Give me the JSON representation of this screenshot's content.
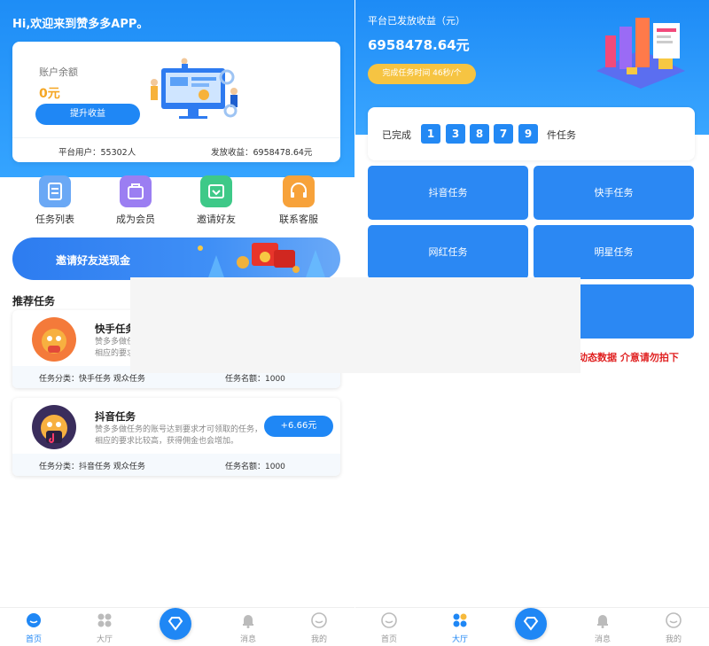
{
  "left": {
    "greeting": "Hi,欢迎来到赞多多APP。",
    "balance": {
      "label": "账户余额",
      "amount": "0元",
      "button": "提升收益",
      "platform_users": "平台用户：55302人",
      "issued_earnings": "发放收益：6958478.64元"
    },
    "menu": [
      {
        "label": "任务列表",
        "icon": "task-list-icon",
        "color": "#6aa8f5"
      },
      {
        "label": "成为会员",
        "icon": "member-icon",
        "color": "#9b7ef2"
      },
      {
        "label": "邀请好友",
        "icon": "invite-icon",
        "color": "#3ec988"
      },
      {
        "label": "联系客服",
        "icon": "service-icon",
        "color": "#f7a23a"
      }
    ],
    "invite_banner": "邀请好友送现金",
    "recommended_title": "推荐任务",
    "tasks": [
      {
        "title": "快手任务",
        "desc": "赞多多做任务的账号达到要求才可领取的任务，相应的要求比较高，获得佣金也会增加。",
        "category": "任务分类：快手任务 观众任务",
        "quota": "任务名额：1000",
        "reward": ""
      },
      {
        "title": "抖音任务",
        "desc": "赞多多做任务的账号达到要求才可领取的任务，相应的要求比较高，获得佣金也会增加。",
        "category": "任务分类：抖音任务 观众任务",
        "quota": "任务名额：1000",
        "reward": "+6.66元"
      }
    ],
    "nav": [
      "首页",
      "大厅",
      "",
      "消息",
      "我的"
    ]
  },
  "right": {
    "earnings_label": "平台已发放收益（元）",
    "earnings_amount": "6958478.64元",
    "pill": "完成任务时间 46秒/个",
    "completed_label": "已完成",
    "completed_digits": [
      "1",
      "3",
      "8",
      "7",
      "9"
    ],
    "completed_suffix": "件任务",
    "tiles": [
      "抖音任务",
      "快手任务",
      "网红任务",
      "明星任务"
    ],
    "notice": "动态数据 介意请勿拍下",
    "nav": [
      "首页",
      "大厅",
      "",
      "消息",
      "我的"
    ]
  },
  "colors": {
    "primary": "#1f87f5",
    "accent_orange": "#f5a623",
    "pill_yellow": "#f6c442",
    "notice_red": "#e02020"
  }
}
